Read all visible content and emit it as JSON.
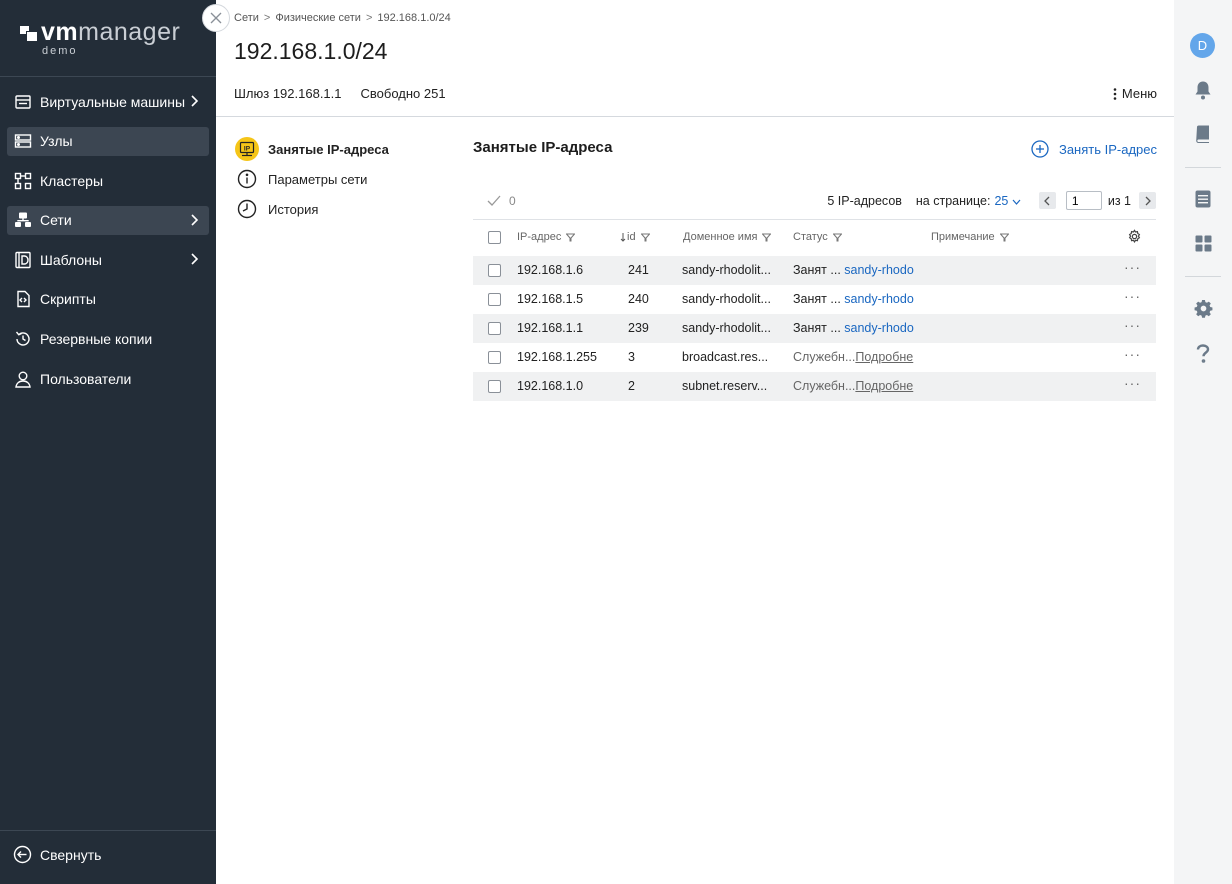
{
  "app": {
    "logo_vm": "vm",
    "logo_manager": "manager",
    "logo_sub": "demo"
  },
  "sidebar": {
    "items": [
      {
        "label": "Виртуальные машины",
        "icon": "vm-icon",
        "has_chevron": true,
        "active": false
      },
      {
        "label": "Узлы",
        "icon": "nodes-icon",
        "has_chevron": false,
        "active": true
      },
      {
        "label": "Кластеры",
        "icon": "clusters-icon",
        "has_chevron": false,
        "active": false
      },
      {
        "label": "Сети",
        "icon": "networks-icon",
        "has_chevron": true,
        "active": true
      },
      {
        "label": "Шаблоны",
        "icon": "templates-icon",
        "has_chevron": true,
        "active": false
      },
      {
        "label": "Скрипты",
        "icon": "scripts-icon",
        "has_chevron": false,
        "active": false
      },
      {
        "label": "Резервные копии",
        "icon": "backups-icon",
        "has_chevron": false,
        "active": false
      },
      {
        "label": "Пользователи",
        "icon": "users-icon",
        "has_chevron": false,
        "active": false
      }
    ],
    "collapse_label": "Свернуть"
  },
  "breadcrumb": {
    "items": [
      "Сети",
      "Физические сети",
      "192.168.1.0/24"
    ],
    "separator": ">"
  },
  "page": {
    "title": "192.168.1.0/24",
    "gateway": "Шлюз 192.168.1.1",
    "free": "Свободно 251",
    "menu_label": "Меню"
  },
  "subnav": {
    "items": [
      {
        "label": "Занятые IP-адреса",
        "icon": "ip-icon",
        "active": true,
        "badge": "IP"
      },
      {
        "label": "Параметры сети",
        "icon": "info-icon",
        "active": false
      },
      {
        "label": "История",
        "icon": "history-icon",
        "active": false
      }
    ]
  },
  "section": {
    "title": "Занятые IP-адреса",
    "take_ip_label": "Занять IP-адрес"
  },
  "toolbar": {
    "selected_count": "0",
    "total_label": "5 IP-адресов",
    "per_page_label": "на странице:",
    "per_page_value": "25",
    "page_value": "1",
    "of_label": "из",
    "page_total": "1"
  },
  "table": {
    "columns": {
      "ip": "IP-адрес",
      "id": "id",
      "domain": "Доменное имя",
      "status": "Статус",
      "note": "Примечание"
    },
    "rows": [
      {
        "ip": "192.168.1.6",
        "id": "241",
        "domain": "sandy-rhodolit...",
        "status": "Занят ...",
        "status_link": "sandy-rhodo",
        "link_style": "blue"
      },
      {
        "ip": "192.168.1.5",
        "id": "240",
        "domain": "sandy-rhodolit...",
        "status": "Занят ...",
        "status_link": "sandy-rhodo",
        "link_style": "blue"
      },
      {
        "ip": "192.168.1.1",
        "id": "239",
        "domain": "sandy-rhodolit...",
        "status": "Занят ...",
        "status_link": "sandy-rhodo",
        "link_style": "blue"
      },
      {
        "ip": "192.168.1.255",
        "id": "3",
        "domain": "broadcast.res...",
        "status": "Служебн...",
        "status_link": "Подробне",
        "link_style": "gray"
      },
      {
        "ip": "192.168.1.0",
        "id": "2",
        "domain": "subnet.reserv...",
        "status": "Служебн...",
        "status_link": "Подробне",
        "link_style": "gray"
      }
    ],
    "row_action": "···"
  },
  "rail": {
    "avatar_letter": "D"
  },
  "colors": {
    "sidebar_bg": "#232d38",
    "accent": "#1a67c1",
    "avatar": "#63a6ea",
    "ip_badge": "#f5c518"
  }
}
